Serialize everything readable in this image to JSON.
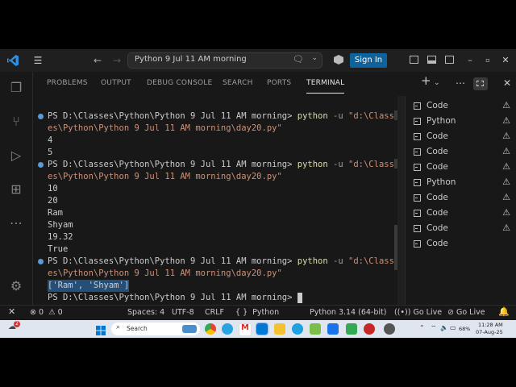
{
  "window": {
    "search_text": "Python 9 Jul 11 AM morning",
    "signin_label": "Sign In"
  },
  "panel": {
    "tabs": [
      "PROBLEMS",
      "OUTPUT",
      "DEBUG CONSOLE",
      "SEARCH",
      "PORTS",
      "TERMINAL"
    ],
    "active_tab": "TERMINAL"
  },
  "terminal": {
    "prompt": "PS D:\\Classes\\Python\\Python 9 Jul 11 AM morning>",
    "command": "python",
    "flag": "-u",
    "path_start": "\"d:\\Class",
    "path_cont": "es\\Python\\Python 9 Jul 11 AM morning\\day20.py\"",
    "outputs": {
      "run1": [
        "4",
        "5"
      ],
      "run2": [
        "10",
        "20",
        "Ram",
        "Shyam",
        "19.32",
        "True"
      ],
      "run3": [
        "['Ram', 'Shyam']"
      ]
    }
  },
  "terminal_list": [
    {
      "label": "Code"
    },
    {
      "label": "Python"
    },
    {
      "label": "Code"
    },
    {
      "label": "Code"
    },
    {
      "label": "Code"
    },
    {
      "label": "Python"
    },
    {
      "label": "Code"
    },
    {
      "label": "Code"
    },
    {
      "label": "Code"
    },
    {
      "label": "Code"
    }
  ],
  "statusbar": {
    "errors": "0",
    "warnings": "0",
    "spaces": "Spaces: 4",
    "encoding": "UTF-8",
    "eol": "CRLF",
    "language": "Python",
    "interpreter": "Python 3.14 (64-bit)",
    "golive1": "Go Live",
    "golive2": "Go Live"
  },
  "taskbar": {
    "search_placeholder": "Search",
    "battery": "68%",
    "time": "11:28 AM",
    "date": "07-Aug-25",
    "notification_badge": "2"
  },
  "colors": {
    "accent_blue": "#0e639c",
    "terminal_bg": "#181818",
    "string_color": "#ce9178",
    "command_color": "#dcdcaa"
  }
}
